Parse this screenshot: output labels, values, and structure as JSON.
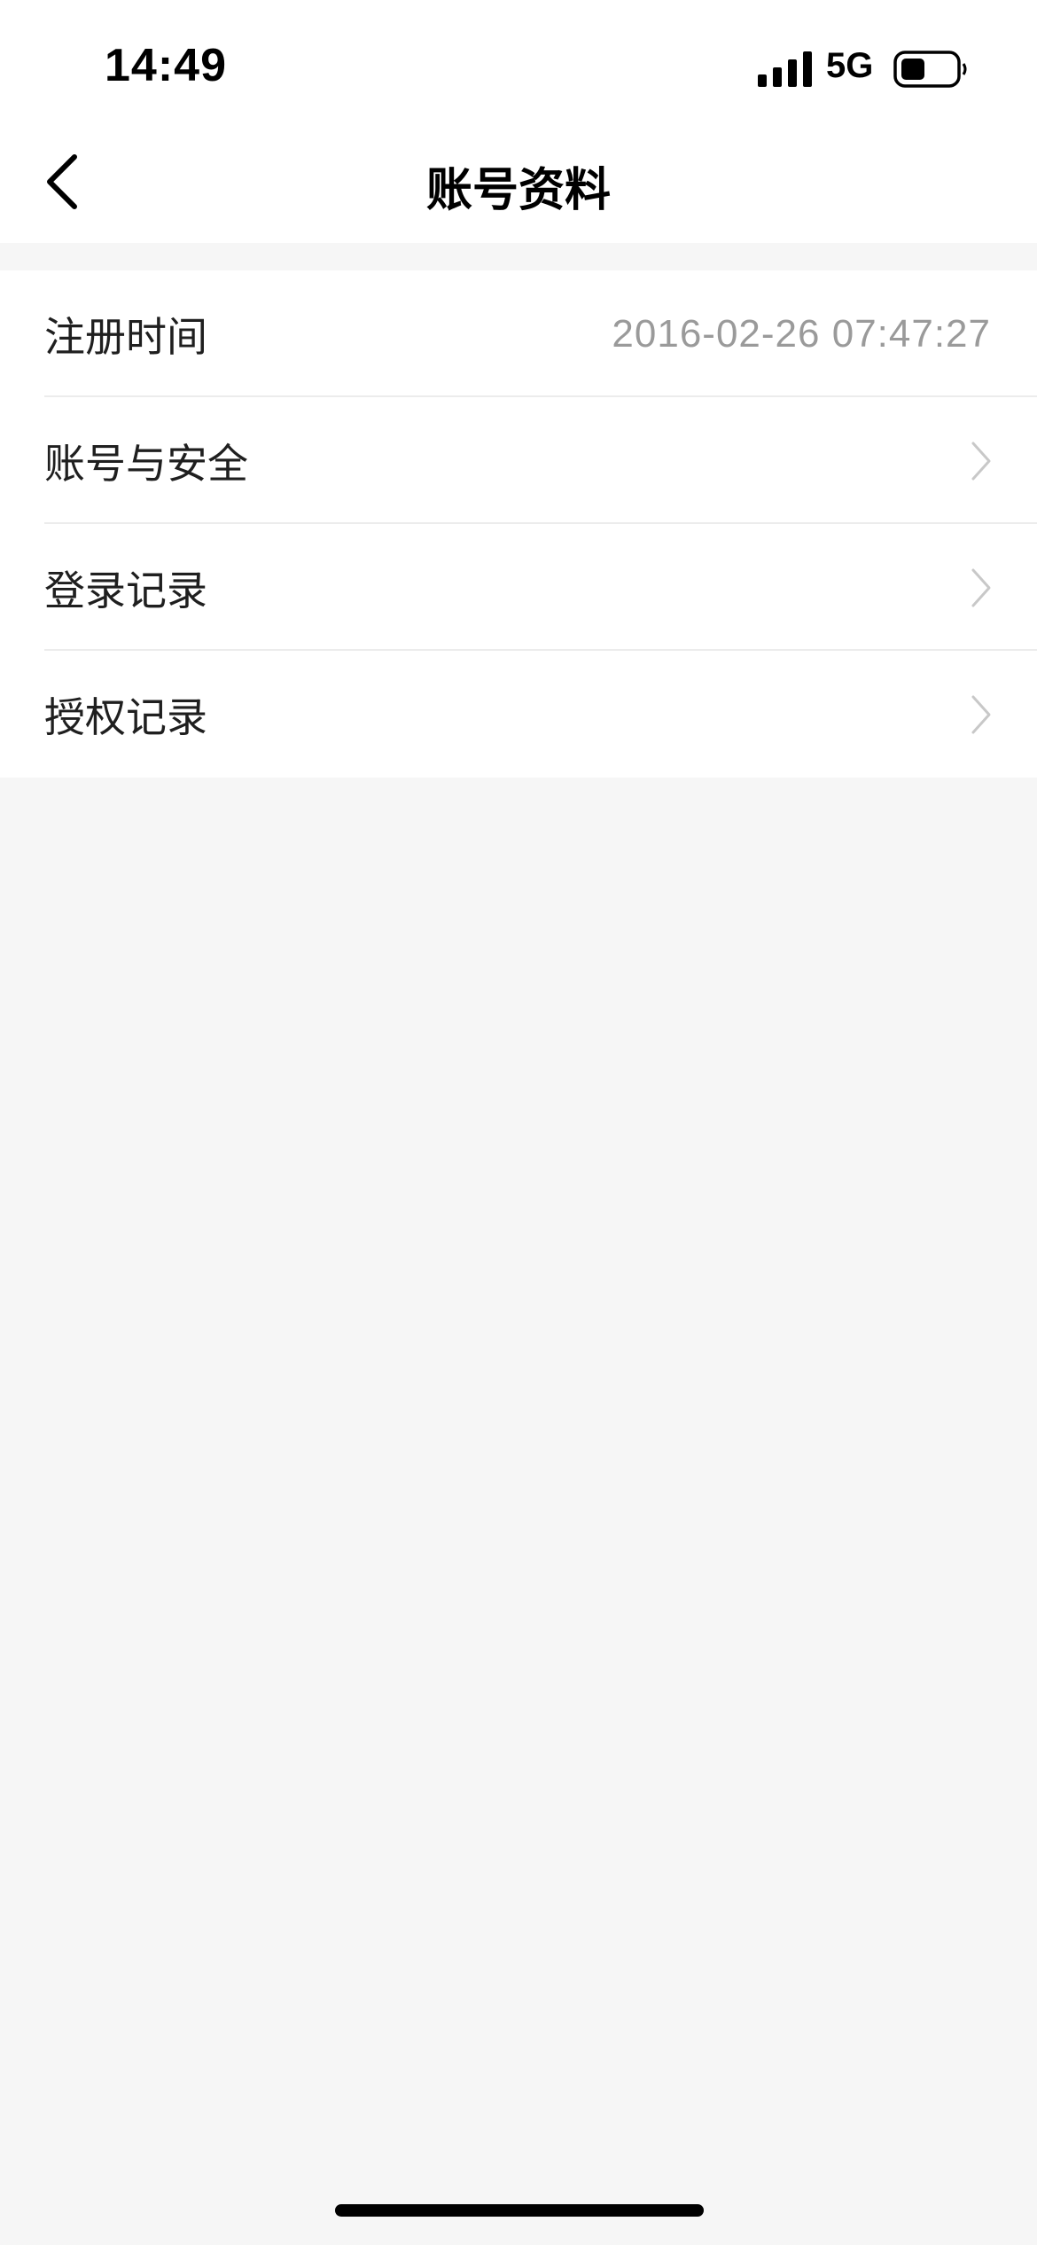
{
  "status_bar": {
    "time": "14:49",
    "network": "5G",
    "signal_icon": "cellular-signal-icon",
    "battery_icon": "battery-icon",
    "battery_level": 0.45
  },
  "nav": {
    "title": "账号资料",
    "back_icon": "chevron-left-icon"
  },
  "rows": [
    {
      "label": "注册时间",
      "value": "2016-02-26 07:47:27"
    },
    {
      "label": "账号与安全",
      "icon": "chevron-right-icon"
    },
    {
      "label": "登录记录",
      "icon": "chevron-right-icon"
    },
    {
      "label": "授权记录",
      "icon": "chevron-right-icon"
    }
  ],
  "colors": {
    "background": "#f6f6f6",
    "surface": "#ffffff",
    "secondary_text": "#9a9a9a",
    "chevron": "#c8c8c8"
  }
}
